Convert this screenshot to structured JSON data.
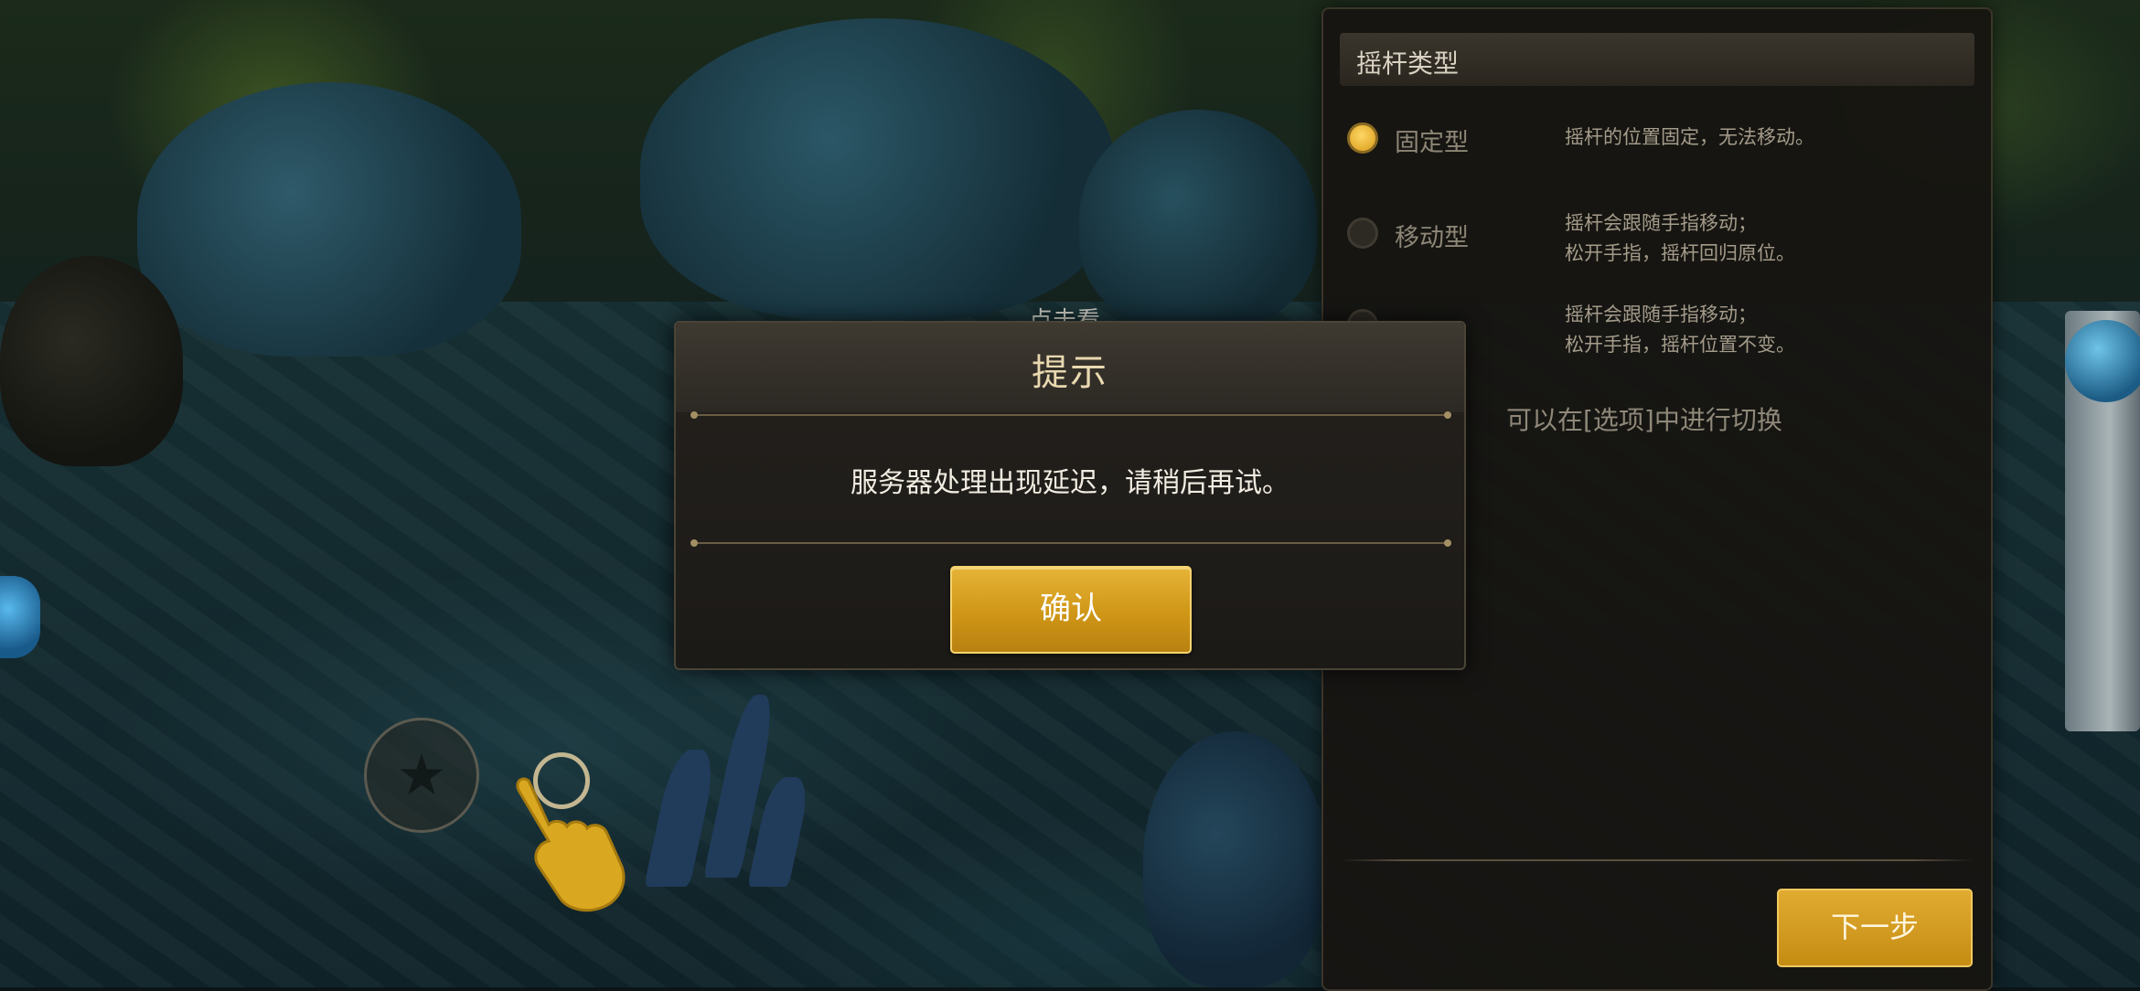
{
  "dialog": {
    "title": "提示",
    "message": "服务器处理出现延迟，请稍后再试。",
    "confirm_label": "确认"
  },
  "joystick_panel": {
    "title": "摇杆类型",
    "options": [
      {
        "label": "固定型",
        "description": "摇杆的位置固定，无法移动。",
        "selected": true
      },
      {
        "label": "移动型",
        "description": "摇杆会跟随手指移动；\n松开手指，摇杆回归原位。",
        "selected": false
      },
      {
        "label": "",
        "description": "摇杆会跟随手指移动；\n松开手指，摇杆位置不变。",
        "selected": false
      }
    ],
    "note": "可以在[选项]中进行切换",
    "next_label": "下一步"
  },
  "game": {
    "name_tag": "点击看"
  },
  "colors": {
    "accent_gold": "#d79a16",
    "dialog_title": "#e9d9b0",
    "panel_bg": "#161411"
  },
  "icons": [
    "star-icon",
    "tap-hand-icon",
    "radio-selected-icon",
    "radio-unselected-icon"
  ]
}
